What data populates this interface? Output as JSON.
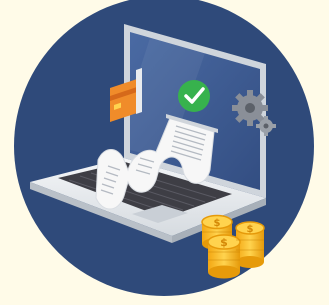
{
  "illustration": {
    "subject": "laptop-payment-receipt",
    "icons": [
      "check-icon",
      "credit-card-icon",
      "gear-icon",
      "dollar-coin-icon",
      "receipt-icon",
      "laptop-icon"
    ],
    "colors": {
      "page_background": "#fffbe8",
      "circle": "#2f4a7a",
      "screen": "#3b5688",
      "laptop_body": "#e9ecef",
      "keyboard": "#3e3e45",
      "receipt": "#f7f7f7",
      "check_badge": "#37b24d",
      "card": "#f08c2a",
      "gear": "#8a8f98",
      "coin": "#f5b81c"
    }
  }
}
